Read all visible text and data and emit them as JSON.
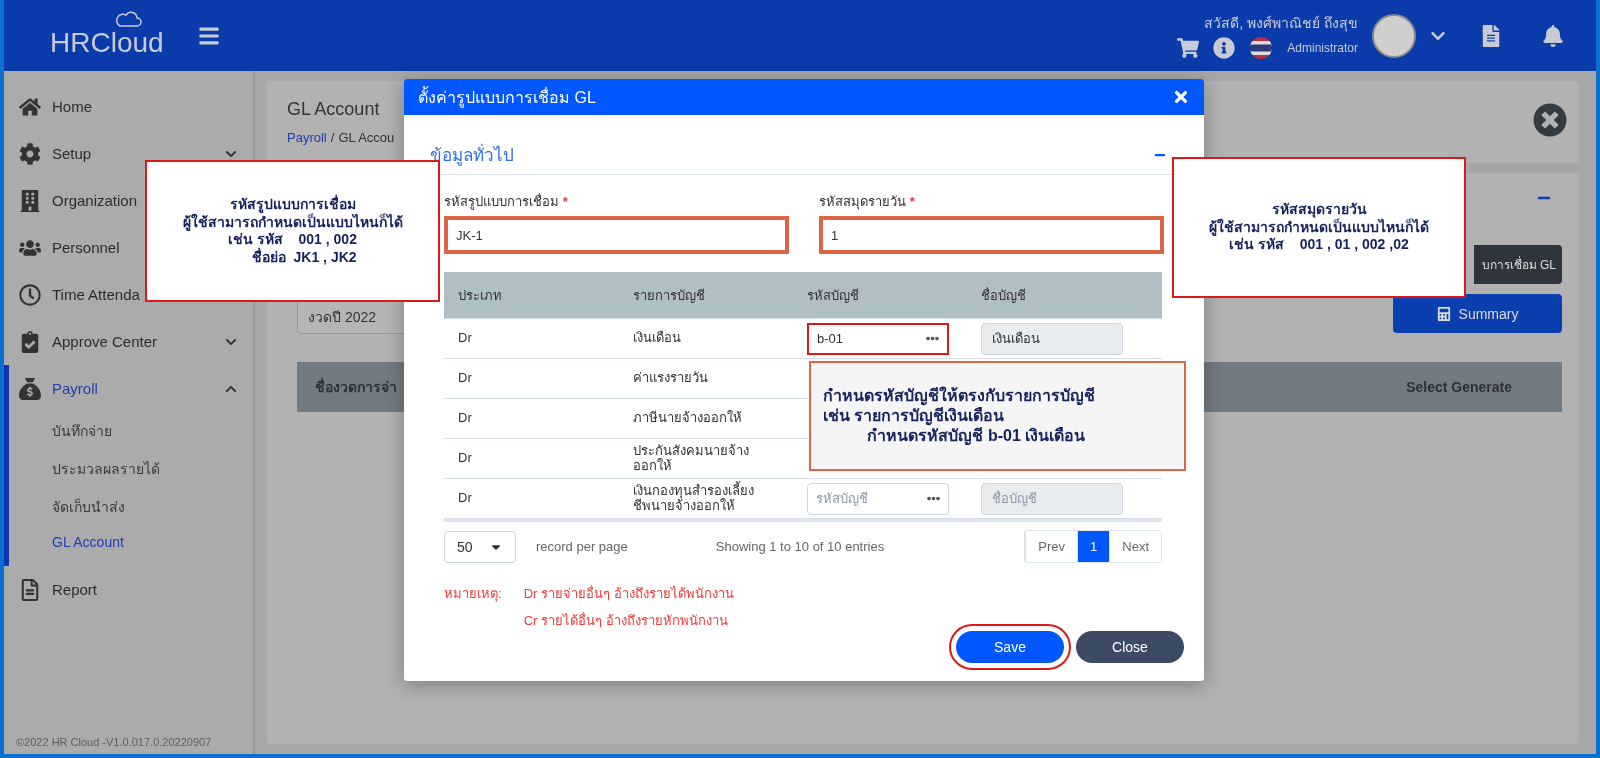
{
  "header": {
    "logo": "HRCloud",
    "greeting": "สวัสดี, พงศ์พาณิชย์ ถึงสุข",
    "role": "Administrator"
  },
  "sidebar": {
    "items": [
      {
        "label": "Home",
        "expanded": false,
        "has_caret": false
      },
      {
        "label": "Setup",
        "expanded": false,
        "has_caret": true
      },
      {
        "label": "Organization",
        "expanded": false,
        "has_caret": false
      },
      {
        "label": "Personnel",
        "expanded": false,
        "has_caret": false
      },
      {
        "label": "Time Attenda",
        "expanded": false,
        "has_caret": false
      },
      {
        "label": "Approve Center",
        "expanded": false,
        "has_caret": true
      },
      {
        "label": "Payroll",
        "expanded": true,
        "has_caret": true,
        "children": [
          {
            "label": "บันทึกจ่าย",
            "selected": false
          },
          {
            "label": "ประมวลผลรายได้",
            "selected": false
          },
          {
            "label": "จัดเก็บนำส่ง",
            "selected": false
          },
          {
            "label": "GL Account",
            "selected": true
          }
        ]
      },
      {
        "label": "Report",
        "expanded": false,
        "has_caret": false
      }
    ],
    "footer": "©2022 HR Cloud -V1.0.017.0.20220907"
  },
  "page": {
    "title": "GL Account",
    "breadcrumb": [
      "Payroll",
      "/",
      "GL Accou"
    ],
    "period_field": "งวดปี 2022",
    "link_button": "บการเชื่อม GL",
    "summary_button": "Summary",
    "table_columns": [
      "ชื่องวดการจ่า",
      "Select Generate"
    ]
  },
  "modal": {
    "title": "ตั้งค่ารูปแบบการเชื่อม GL",
    "section": "ข้อมูลทั่วไป",
    "fields": [
      {
        "label": "รหัสรูปแบบการเชื่อม",
        "required_mark": "*",
        "value": "JK-1"
      },
      {
        "label": "รหัสสมุดรายวัน",
        "required_mark": "*",
        "value": "1"
      }
    ],
    "table": {
      "columns": [
        "ประเภท",
        "รายการบัญชี",
        "รหัสบัญชี",
        "ชื่อบัญชี"
      ],
      "rows": [
        {
          "type": "Dr",
          "item": "เงินเดือน",
          "code": {
            "value": "b-01",
            "highlighted": true
          },
          "name": {
            "value": "เงินเดือน"
          }
        },
        {
          "type": "Dr",
          "item": "ค่าแรงรายวัน"
        },
        {
          "type": "Dr",
          "item": "ภาษีนายจ้างออกให้"
        },
        {
          "type": "Dr",
          "item": "ประกันสังคมนายจ้างออกให้"
        },
        {
          "type": "Dr",
          "item": "เงินกองทุนสำรองเลี้ยงชีพนายจ้างออกให้",
          "code": {
            "placeholder": "รหัสบัญชี",
            "highlighted": false
          },
          "name": {
            "placeholder": "ชื่อบัญชี"
          }
        }
      ]
    },
    "page_size": "50",
    "page_size_label": "record per page",
    "showing": "Showing 1 to 10 of 10 entries",
    "pagination": [
      {
        "label": "Prev",
        "selected": false
      },
      {
        "label": "1",
        "selected": true
      },
      {
        "label": "Next",
        "selected": false
      }
    ],
    "note_label": "หมายเหตุ:",
    "notes": [
      "Dr รายจ่ายอื่นๆ อ้างถึงรายได้พนักงาน",
      "Cr รายได้อื่นๆ อ้างถึงรายหักพนักงาน"
    ],
    "buttons": [
      {
        "label": "Save",
        "kind": "primary",
        "highlighted": true
      },
      {
        "label": "Close",
        "kind": "secondary",
        "highlighted": false
      }
    ]
  },
  "callouts": [
    {
      "kind": "left",
      "lines": [
        "รหัสรูปแบบการเชื่อม",
        "ผู้ใช้สามารถกำหนดเป็นแบบไหนก็ได้",
        "เช่น รหัส    001 , 002",
        "      ชื่อย่อ  JK1 , JK2"
      ]
    },
    {
      "kind": "right",
      "lines": [
        "รหัสสมุดรายวัน",
        "ผู้ใช้สามารถกำหนดเป็นแบบไหนก็ได้",
        "เช่น รหัส    001 , 01 , 002 ,02"
      ]
    },
    {
      "kind": "middle",
      "lines": [
        "กำหนดรหัสบัญชีให้ตรงกับรายการบัญชี",
        "เช่น รายการบัญชีเงินเดือน",
        "          กำหนดรหัสบัญชี **b-01** เงินเดือน"
      ]
    }
  ]
}
